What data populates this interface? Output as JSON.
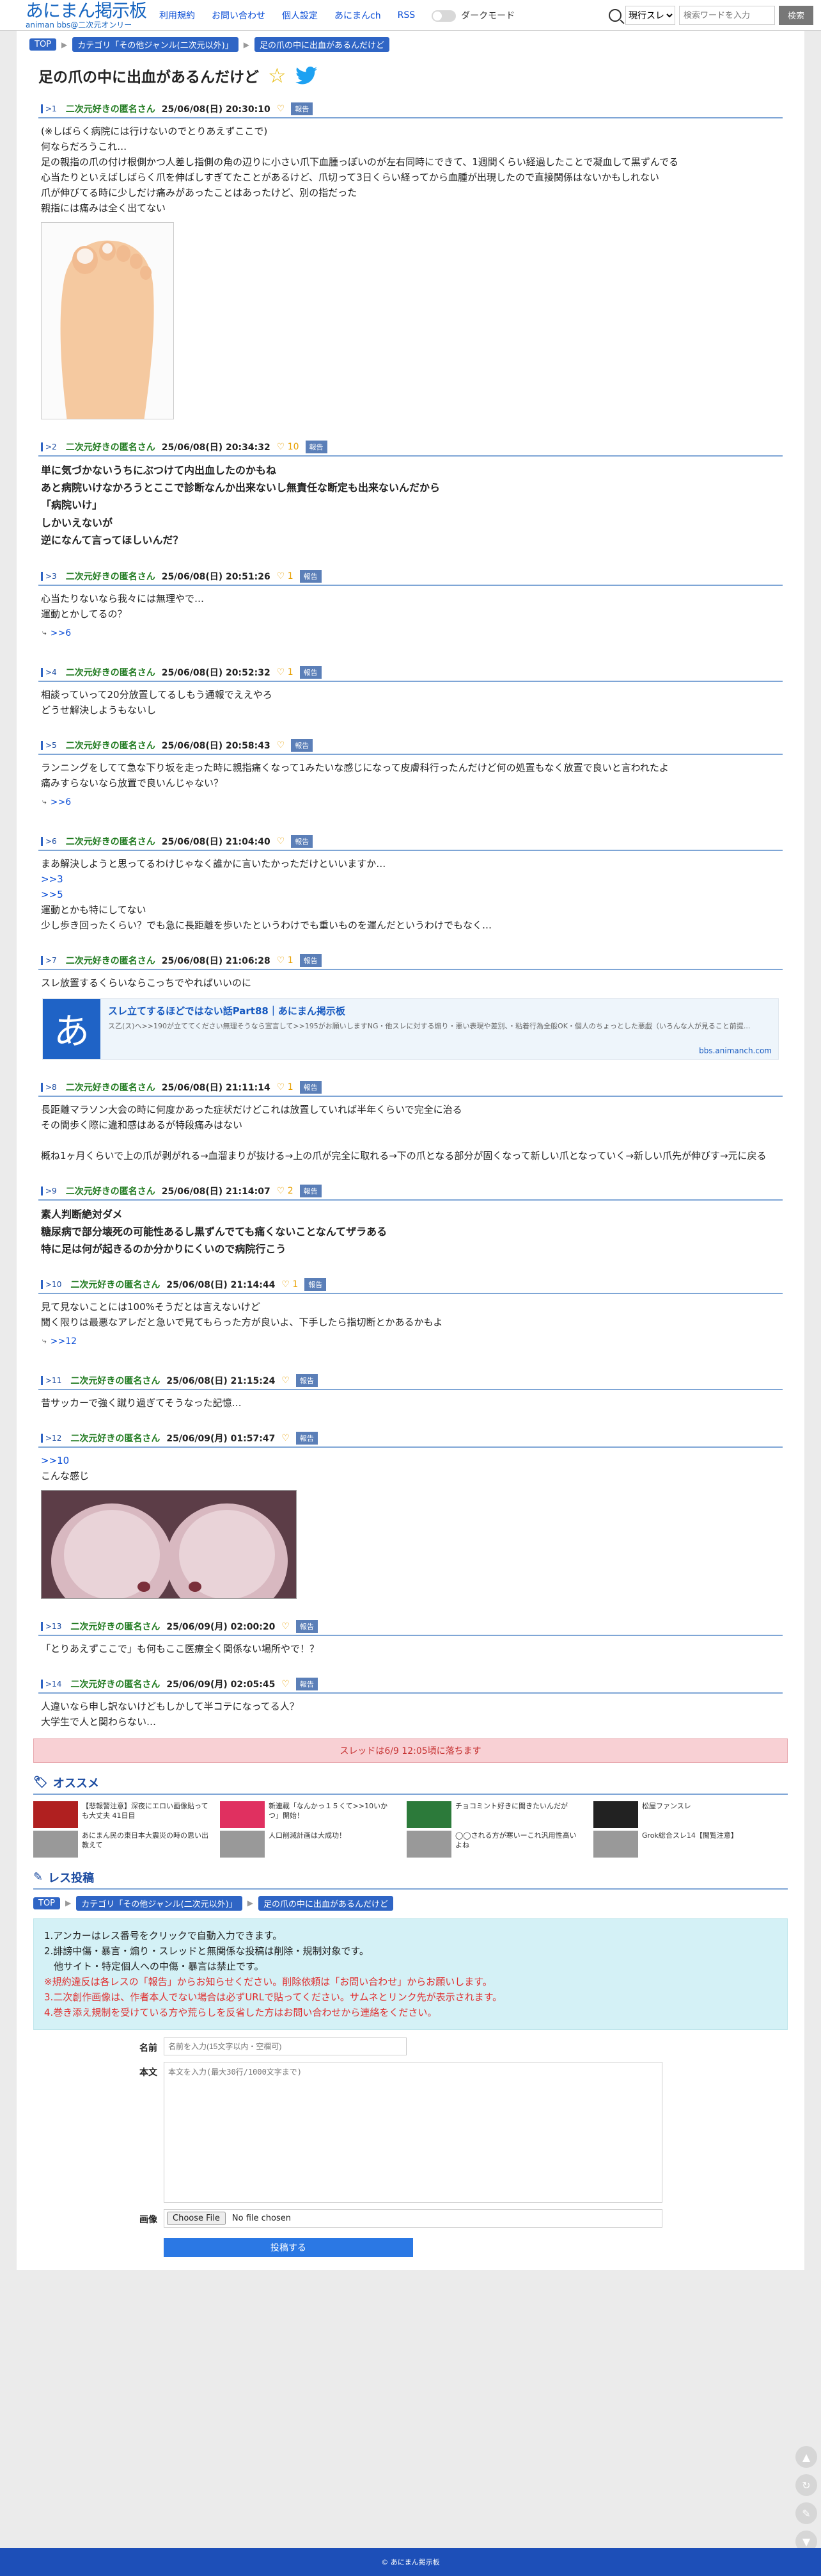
{
  "header": {
    "logo_main": "あにまん掲示板",
    "logo_sub": "animan bbs@二次元オンリー",
    "nav": [
      "利用規約",
      "お問い合わせ",
      "個人設定",
      "あにまんch",
      "RSS"
    ],
    "dark_mode_label": "ダークモード",
    "search_scope": "現行スレ",
    "search_placeholder": "検索ワードを入力",
    "search_button": "検索"
  },
  "breadcrumb": [
    "TOP",
    "カテゴリ「その他ジャンル(二次元以外)」",
    "足の爪の中に出血があるんだけど"
  ],
  "thread_title": "足の爪の中に出血があるんだけど",
  "report_label": "報告",
  "posts": [
    {
      "num": ">1",
      "name": "二次元好きの匿名さん",
      "date": "25/06/08(日) 20:30:10",
      "likes": "",
      "bold": false,
      "lines": [
        "(※しばらく病院には行けないのでとりあえずここで)",
        "何ならだろうこれ…",
        "足の親指の爪の付け根側かつ人差し指側の角の辺りに小さい爪下血腫っぽいのが左右同時にできて、1週間くらい経過したことで凝血して黒ずんでる",
        "心当たりといえばしばらく爪を伸ばしすぎてたことがあるけど、爪切って3日くらい経ってから血腫が出現したので直接関係はないかもしれない",
        "爪が伸びてる時に少しだけ痛みがあったことはあったけど、別の指だった",
        "親指には痛みは全く出てない"
      ],
      "image": "foot",
      "replies": ""
    },
    {
      "num": ">2",
      "name": "二次元好きの匿名さん",
      "date": "25/06/08(日) 20:34:32",
      "likes": "10",
      "bold": true,
      "lines": [
        "単に気づかないうちにぶつけて内出血したのかもね",
        "あと病院いけなかろうとここで診断なんか出来ないし無責任な断定も出来ないんだから",
        "「病院いけ」",
        "しかいえないが",
        "逆になんて言ってほしいんだ？"
      ],
      "image": "",
      "replies": ""
    },
    {
      "num": ">3",
      "name": "二次元好きの匿名さん",
      "date": "25/06/08(日) 20:51:26",
      "likes": "1",
      "bold": false,
      "lines": [
        "心当たりないなら我々には無理やで…",
        "運動とかしてるの？"
      ],
      "image": "",
      "replies": ">>6"
    },
    {
      "num": ">4",
      "name": "二次元好きの匿名さん",
      "date": "25/06/08(日) 20:52:32",
      "likes": "1",
      "bold": false,
      "lines": [
        "相談っていって20分放置してるしもう通報でええやろ",
        "どうせ解決しようもないし"
      ],
      "image": "",
      "replies": ""
    },
    {
      "num": ">5",
      "name": "二次元好きの匿名さん",
      "date": "25/06/08(日) 20:58:43",
      "likes": "",
      "bold": false,
      "lines": [
        "ランニングをしてて急な下り坂を走った時に親指痛くなって1みたいな感じになって皮膚科行ったんだけど何の処置もなく放置で良いと言われたよ",
        "痛みすらないなら放置で良いんじゃない？"
      ],
      "image": "",
      "replies": ">>6"
    },
    {
      "num": ">6",
      "name": "二次元好きの匿名さん",
      "date": "25/06/08(日) 21:04:40",
      "likes": "",
      "bold": false,
      "lines": [
        "まあ解決しようと思ってるわけじゃなく誰かに言いたかっただけといいますか…",
        "@>>3",
        "@>>5",
        "運動とかも特にしてない",
        "少し歩き回ったくらい？でも急に長距離を歩いたというわけでも重いものを運んだというわけでもなく…"
      ],
      "image": "",
      "replies": ""
    },
    {
      "num": ">7",
      "name": "二次元好きの匿名さん",
      "date": "25/06/08(日) 21:06:28",
      "likes": "1",
      "bold": false,
      "lines": [
        "スレ放置するくらいならこっちでやればいいのに"
      ],
      "image": "card",
      "replies": ""
    },
    {
      "num": ">8",
      "name": "二次元好きの匿名さん",
      "date": "25/06/08(日) 21:11:14",
      "likes": "1",
      "bold": false,
      "lines": [
        "長距離マラソン大会の時に何度かあった症状だけどこれは放置していれば半年くらいで完全に治る",
        "その間歩く際に違和感はあるが特段痛みはない",
        "",
        "概ね1ヶ月くらいで上の爪が剥がれる→血溜まりが抜ける→上の爪が完全に取れる→下の爪となる部分が固くなって新しい爪となっていく→新しい爪先が伸びす→元に戻る"
      ],
      "image": "",
      "replies": ""
    },
    {
      "num": ">9",
      "name": "二次元好きの匿名さん",
      "date": "25/06/08(日) 21:14:07",
      "likes": "2",
      "bold": true,
      "lines": [
        "素人判断絶対ダメ",
        "糖尿病で部分壊死の可能性あるし黒ずんでても痛くないことなんてザラある",
        "特に足は何が起きるのか分かりにくいので病院行こう"
      ],
      "image": "",
      "replies": ""
    },
    {
      "num": ">10",
      "name": "二次元好きの匿名さん",
      "date": "25/06/08(日) 21:14:44",
      "likes": "1",
      "bold": false,
      "lines": [
        "見て見ないことには100%そうだとは言えないけど",
        "聞く限りは最悪なアレだと急いで見てもらった方が良いよ、下手したら指切断とかあるかもよ"
      ],
      "image": "",
      "replies": ">>12"
    },
    {
      "num": ">11",
      "name": "二次元好きの匿名さん",
      "date": "25/06/08(日) 21:15:24",
      "likes": "",
      "bold": false,
      "lines": [
        "昔サッカーで強く蹴り過ぎてそうなった記憶…"
      ],
      "image": "",
      "replies": ""
    },
    {
      "num": ">12",
      "name": "二次元好きの匿名さん",
      "date": "25/06/09(月) 01:57:47",
      "likes": "",
      "bold": false,
      "lines": [
        "@>>10",
        "こんな感じ"
      ],
      "image": "nail",
      "replies": ""
    },
    {
      "num": ">13",
      "name": "二次元好きの匿名さん",
      "date": "25/06/09(月) 02:00:20",
      "likes": "",
      "bold": false,
      "lines": [
        "「とりあえずここで」も何もここ医療全く関係ない場所やで！？"
      ],
      "image": "",
      "replies": ""
    },
    {
      "num": ">14",
      "name": "二次元好きの匿名さん",
      "date": "25/06/09(月) 02:05:45",
      "likes": "",
      "bold": false,
      "lines": [
        "人違いなら申し訳ないけどもしかして半コテになってる人？",
        "大学生で人と関わらない…"
      ],
      "image": "",
      "replies": ""
    }
  ],
  "card": {
    "logo": "あ",
    "title": "スレ立てするほどではない話Part88｜あにまん掲示板",
    "desc": "ス乙(ス)へ>>190が立ててください無理そうなら宣言して>>195がお願いしますNG・他スレに対する煽り・悪い表現や差別、・粘着行為全般OK・個人のちょっとした悪戯（いろんな人が見ること前提...",
    "domain": "bbs.animanch.com"
  },
  "notice": "スレッドは6/9 12:05頃に落ちます",
  "recommend_title": "オススメ",
  "recommend": [
    {
      "text": "【悲報警注意】深夜にエロい画像貼っても大丈夫 41日目",
      "sub": "あにまん民の東日本大震災の時の思い出教えて"
    },
    {
      "text": "新連載「なんかっ１５くて>>10いかつ」開始！",
      "sub": "人口削減計画は大成功！"
    },
    {
      "text": "チョコミント好きに聞きたいんだが",
      "sub": "◯◯される方が寒いーこれ汎用性高いよね"
    },
    {
      "text": "松屋ファンスレ",
      "sub": "Grok総合スレ14【閲覧注意】"
    }
  ],
  "form": {
    "section_title": "レス投稿",
    "rules": [
      "1.アンカーはレス番号をクリックで自動入力できます。",
      "2.誹謗中傷・暴言・煽り・スレッドと無関係な投稿は削除・規制対象です。",
      "　他サイト・特定個人への中傷・暴言は禁止です。",
      "※規約違反は各レスの「報告」からお知らせください。削除依頼は「お問い合わせ」からお願いします。",
      "3.二次創作画像は、作者本人でない場合は必ずURLで貼ってください。サムネとリンク先が表示されます。",
      "4.巻き添え規制を受けている方や荒らしを反省した方はお問い合わせから連絡をください。"
    ],
    "name_label": "名前",
    "name_placeholder": "名前を入力(15文字以内・空欄可)",
    "body_label": "本文",
    "body_placeholder": "本文を入力(最大30行/1000文字まで)",
    "image_label": "画像",
    "file_button": "Choose File",
    "file_status": "No file chosen",
    "submit": "投稿する"
  },
  "footer": "© あにまん掲示板"
}
